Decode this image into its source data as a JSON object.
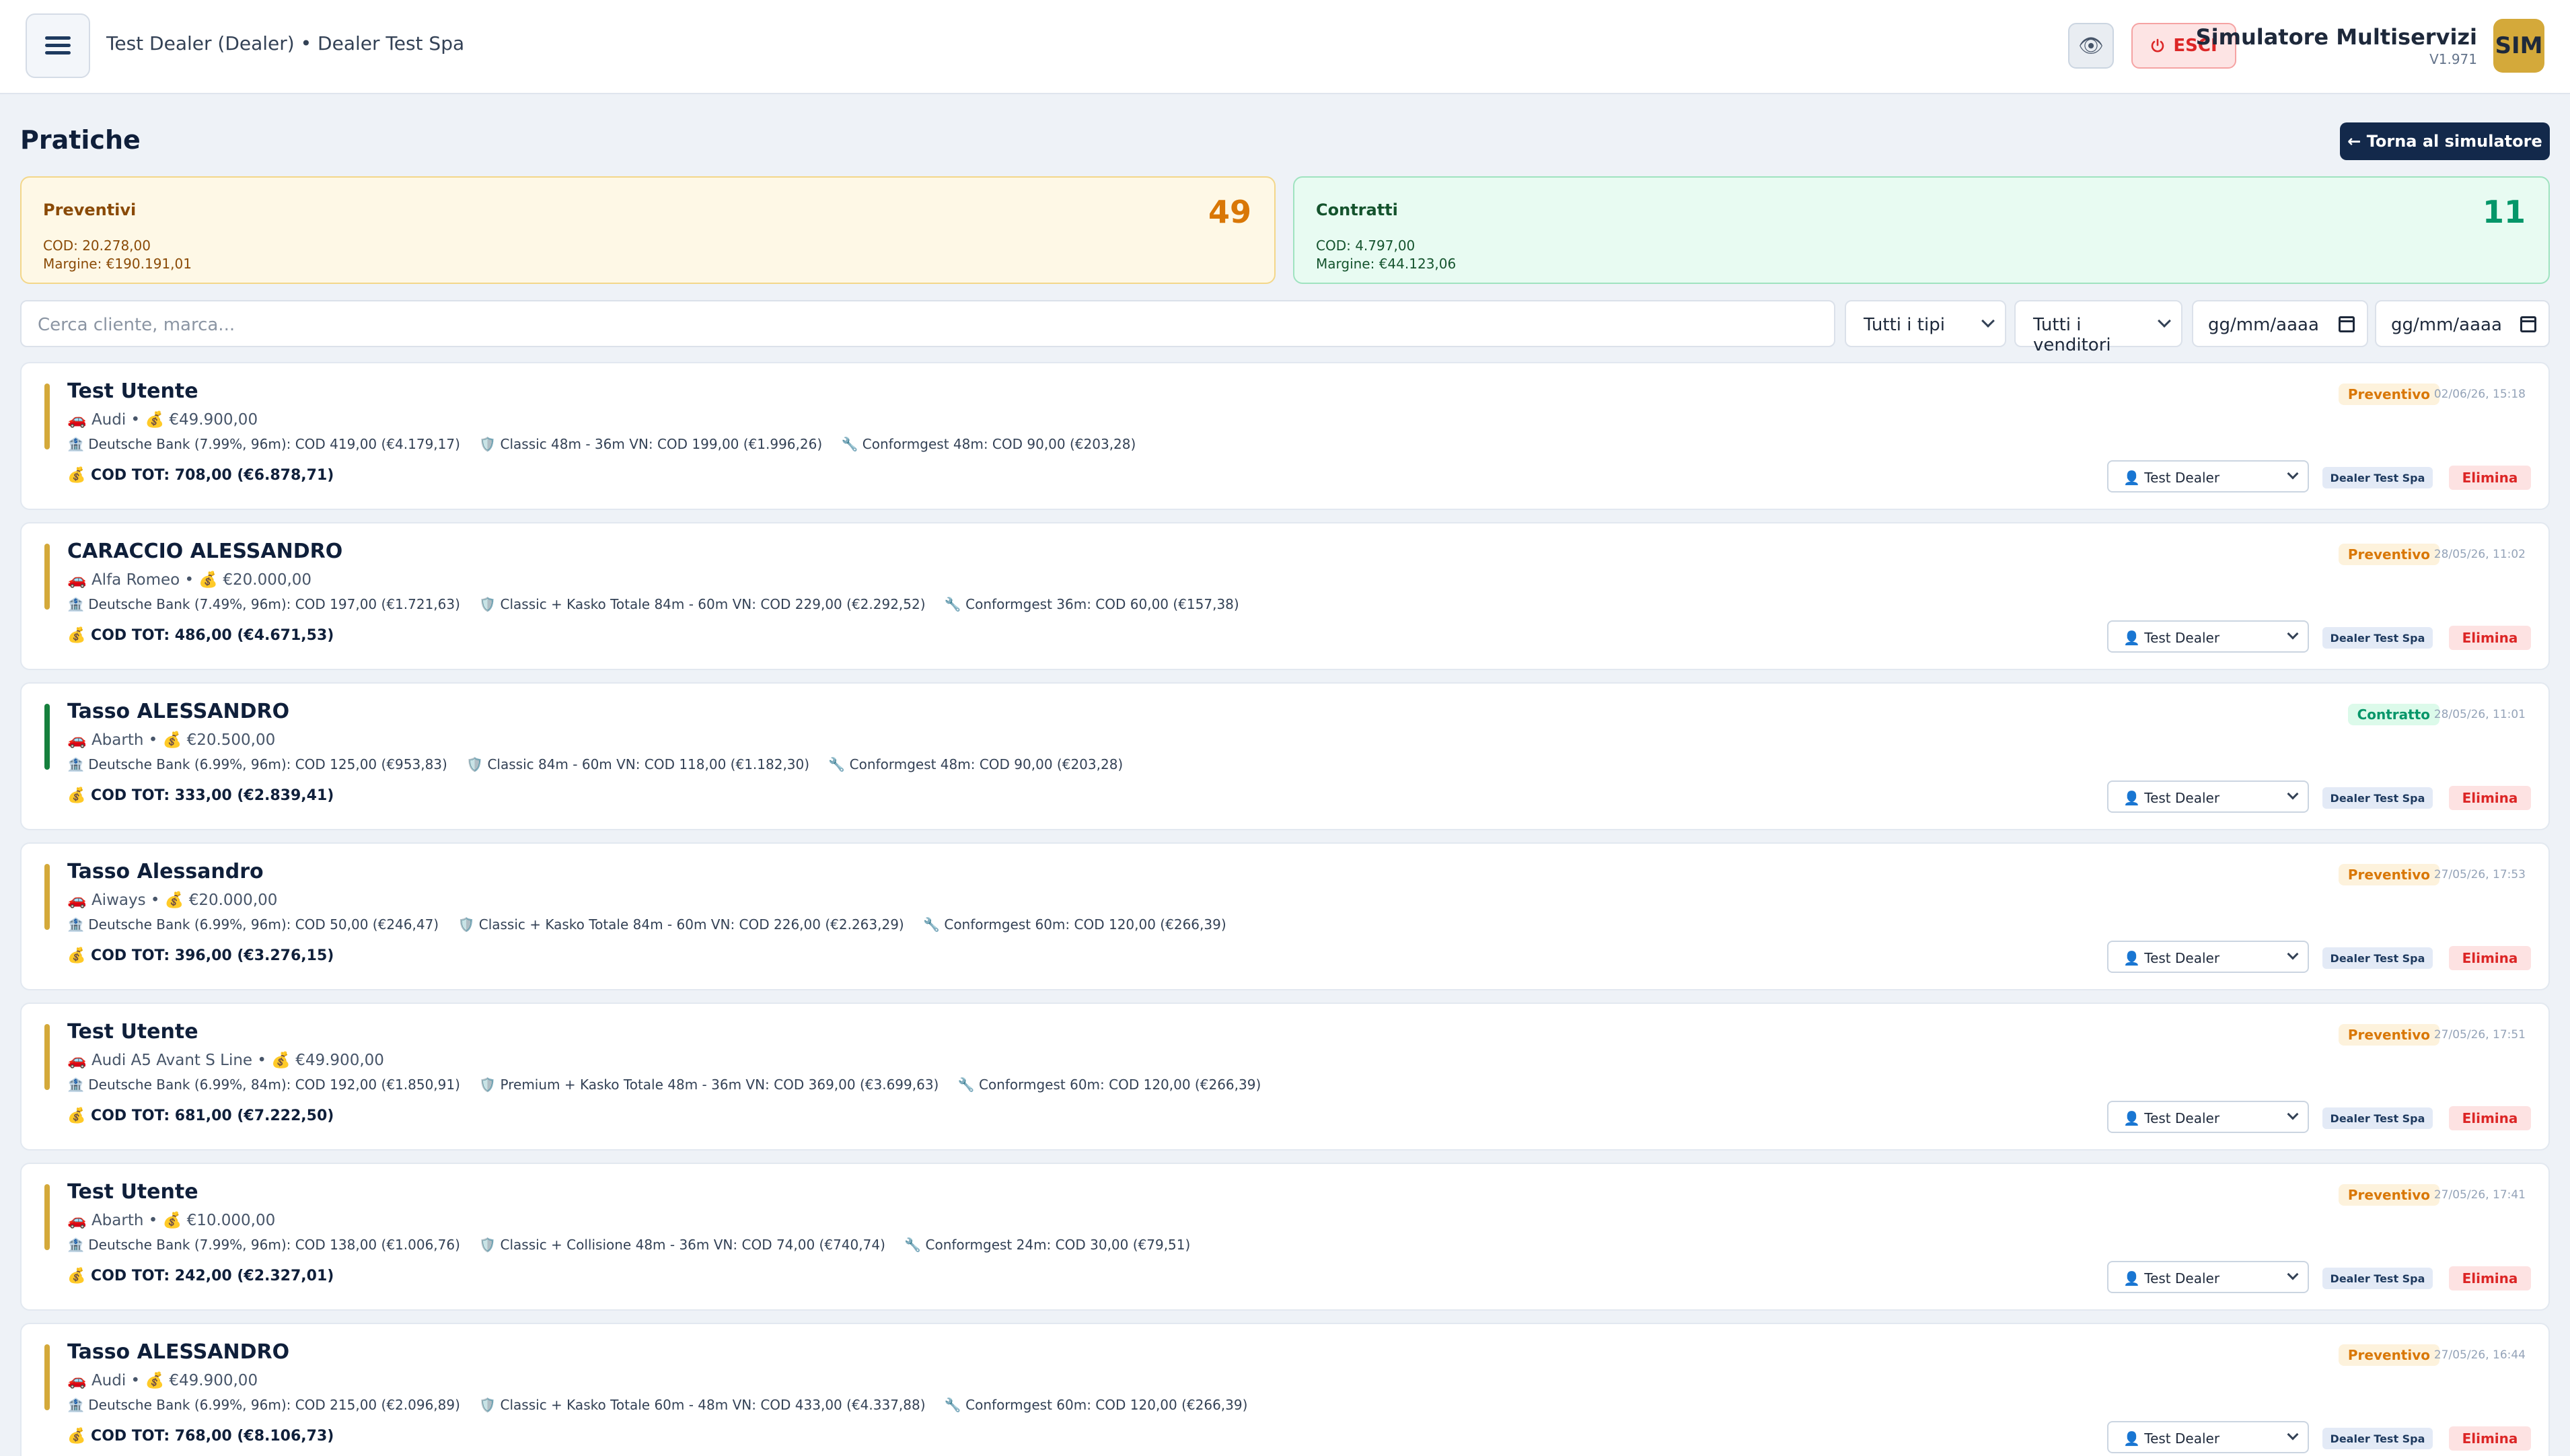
{
  "header": {
    "breadcrumb": "Test Dealer (Dealer) • Dealer Test Spa",
    "exit_label": "ESCI",
    "app_title": "Simulatore Multiservizi",
    "version": "V1.971",
    "avatar": "SIM",
    "eye_icon": "👁"
  },
  "page": {
    "title": "Pratiche",
    "back_label": "← Torna al simulatore"
  },
  "summary": {
    "preventivi": {
      "label": "Preventivi",
      "count": "49",
      "cod": "COD: 20.278,00",
      "margin": "Margine: €190.191,01"
    },
    "contratti": {
      "label": "Contratti",
      "count": "11",
      "cod": "COD: 4.797,00",
      "margin": "Margine: €44.123,06"
    }
  },
  "filters": {
    "search_placeholder": "Cerca cliente, marca...",
    "type": "Tutti i tipi",
    "seller": "Tutti i venditori",
    "date_from": "gg/mm/aaaa",
    "date_to": "gg/mm/aaaa"
  },
  "colors": {
    "preventivo": "#d4a93a",
    "contratto": "#15803d"
  },
  "items": [
    {
      "client": "Test Utente",
      "vehicle": "🚗 Audi • 💰 €49.900,00",
      "bank": "🏦 Deutsche Bank (7.99%, 96m): COD 419,00 (€4.179,17)",
      "insurance": "🛡️ Classic 48m - 36m VN: COD 199,00 (€1.996,26)",
      "service": "🔧 Conformgest 48m: COD 90,00 (€203,28)",
      "total": "💰 COD TOT: 708,00 (€6.878,71)",
      "status": "Preventivo",
      "status_type": "prev",
      "date": "02/06/26, 15:18",
      "seller": "👤 Test Dealer",
      "dealer": "Dealer Test Spa",
      "delete": "Elimina"
    },
    {
      "client": "CARACCIO ALESSANDRO",
      "vehicle": "🚗 Alfa Romeo • 💰 €20.000,00",
      "bank": "🏦 Deutsche Bank (7.49%, 96m): COD 197,00 (€1.721,63)",
      "insurance": "🛡️ Classic + Kasko Totale 84m - 60m VN: COD 229,00 (€2.292,52)",
      "service": "🔧 Conformgest 36m: COD 60,00 (€157,38)",
      "total": "💰 COD TOT: 486,00 (€4.671,53)",
      "status": "Preventivo",
      "status_type": "prev",
      "date": "28/05/26, 11:02",
      "seller": "👤 Test Dealer",
      "dealer": "Dealer Test Spa",
      "delete": "Elimina"
    },
    {
      "client": "Tasso ALESSANDRO",
      "vehicle": "🚗 Abarth • 💰 €20.500,00",
      "bank": "🏦 Deutsche Bank (6.99%, 96m): COD 125,00 (€953,83)",
      "insurance": "🛡️ Classic 84m - 60m VN: COD 118,00 (€1.182,30)",
      "service": "🔧 Conformgest 48m: COD 90,00 (€203,28)",
      "total": "💰 COD TOT: 333,00 (€2.839,41)",
      "status": "Contratto",
      "status_type": "contr",
      "date": "28/05/26, 11:01",
      "seller": "👤 Test Dealer",
      "dealer": "Dealer Test Spa",
      "delete": "Elimina"
    },
    {
      "client": "Tasso Alessandro",
      "vehicle": "🚗 Aiways • 💰 €20.000,00",
      "bank": "🏦 Deutsche Bank (6.99%, 96m): COD 50,00 (€246,47)",
      "insurance": "🛡️ Classic + Kasko Totale 84m - 60m VN: COD 226,00 (€2.263,29)",
      "service": "🔧 Conformgest 60m: COD 120,00 (€266,39)",
      "total": "💰 COD TOT: 396,00 (€3.276,15)",
      "status": "Preventivo",
      "status_type": "prev",
      "date": "27/05/26, 17:53",
      "seller": "👤 Test Dealer",
      "dealer": "Dealer Test Spa",
      "delete": "Elimina"
    },
    {
      "client": "Test Utente",
      "vehicle": "🚗 Audi A5 Avant S Line • 💰 €49.900,00",
      "bank": "🏦 Deutsche Bank (6.99%, 84m): COD 192,00 (€1.850,91)",
      "insurance": "🛡️ Premium + Kasko Totale 48m - 36m VN: COD 369,00 (€3.699,63)",
      "service": "🔧 Conformgest 60m: COD 120,00 (€266,39)",
      "total": "💰 COD TOT: 681,00 (€7.222,50)",
      "status": "Preventivo",
      "status_type": "prev",
      "date": "27/05/26, 17:51",
      "seller": "👤 Test Dealer",
      "dealer": "Dealer Test Spa",
      "delete": "Elimina"
    },
    {
      "client": "Test Utente",
      "vehicle": "🚗 Abarth • 💰 €10.000,00",
      "bank": "🏦 Deutsche Bank (7.99%, 96m): COD 138,00 (€1.006,76)",
      "insurance": "🛡️ Classic + Collisione 48m - 36m VN: COD 74,00 (€740,74)",
      "service": "🔧 Conformgest 24m: COD 30,00 (€79,51)",
      "total": "💰 COD TOT: 242,00 (€2.327,01)",
      "status": "Preventivo",
      "status_type": "prev",
      "date": "27/05/26, 17:41",
      "seller": "👤 Test Dealer",
      "dealer": "Dealer Test Spa",
      "delete": "Elimina"
    },
    {
      "client": "Tasso ALESSANDRO",
      "vehicle": "🚗 Audi • 💰 €49.900,00",
      "bank": "🏦 Deutsche Bank (6.99%, 96m): COD 215,00 (€2.096,89)",
      "insurance": "🛡️ Classic + Kasko Totale 60m - 48m VN: COD 433,00 (€4.337,88)",
      "service": "🔧 Conformgest 60m: COD 120,00 (€266,39)",
      "total": "💰 COD TOT: 768,00 (€8.106,73)",
      "status": "Preventivo",
      "status_type": "prev",
      "date": "27/05/26, 16:44",
      "seller": "👤 Test Dealer",
      "dealer": "Dealer Test Spa",
      "delete": "Elimina"
    }
  ]
}
